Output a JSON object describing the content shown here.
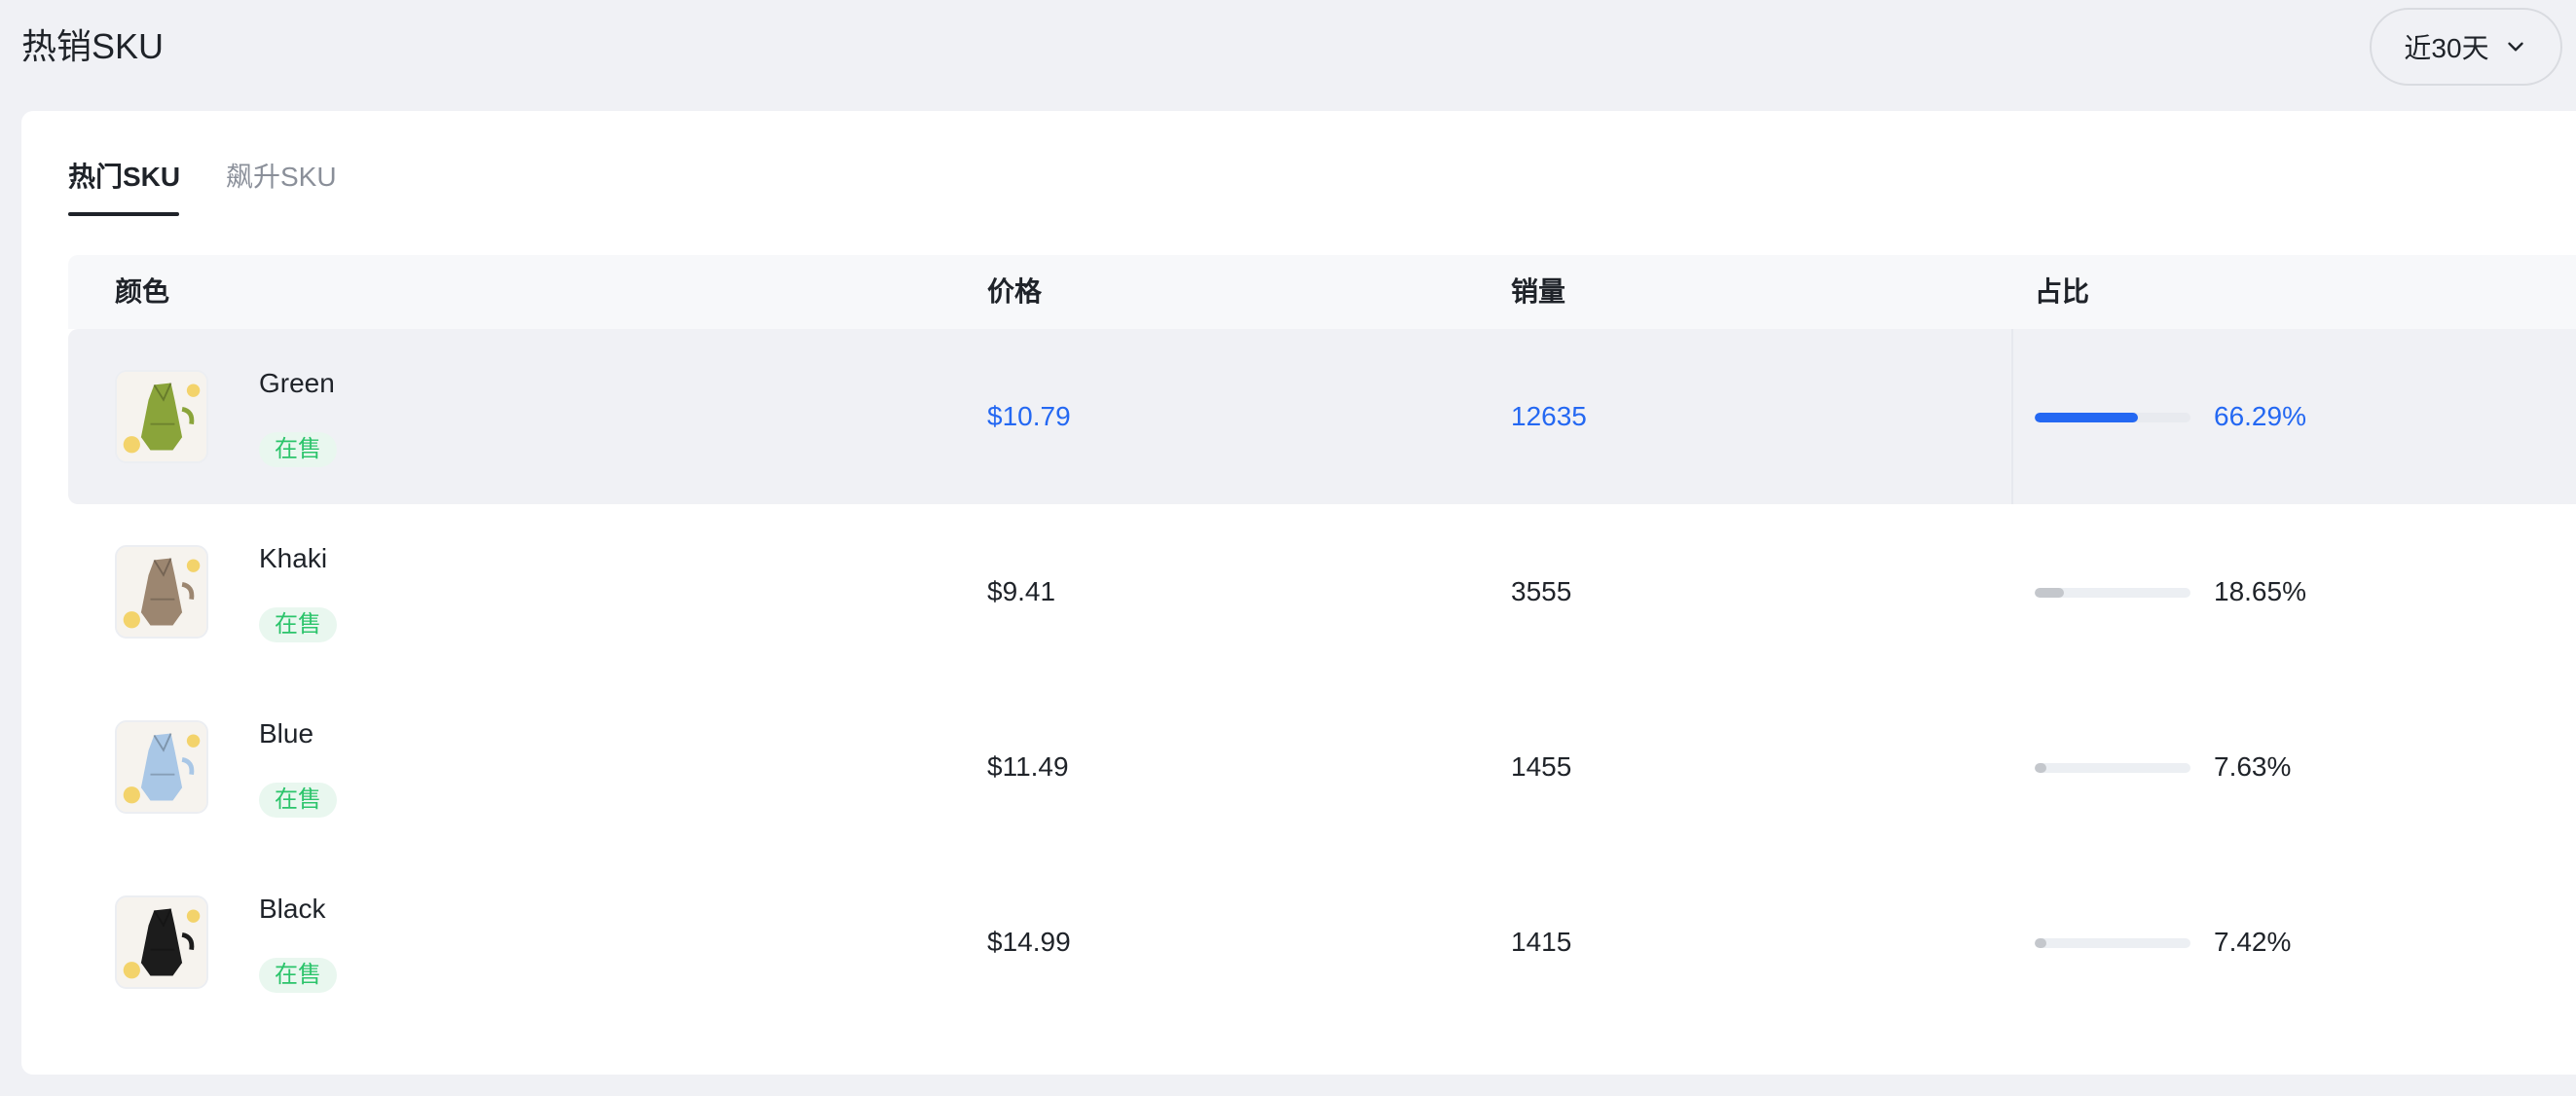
{
  "header": {
    "title": "热销SKU",
    "range_select": {
      "value": "近30天",
      "icon": "chevron-down-icon"
    }
  },
  "tabs": [
    {
      "label": "热门SKU",
      "active": true
    },
    {
      "label": "飙升SKU",
      "active": false
    }
  ],
  "table": {
    "columns": [
      "颜色",
      "价格",
      "销量",
      "占比"
    ],
    "rows": [
      {
        "color": "Green",
        "status": "在售",
        "price": "$10.79",
        "sales": "12635",
        "share": "66.29%",
        "share_value": 66.29,
        "swatch": "#8aa43a",
        "highlighted": true
      },
      {
        "color": "Khaki",
        "status": "在售",
        "price": "$9.41",
        "sales": "3555",
        "share": "18.65%",
        "share_value": 18.65,
        "swatch": "#9c8670",
        "highlighted": false
      },
      {
        "color": "Blue",
        "status": "在售",
        "price": "$11.49",
        "sales": "1455",
        "share": "7.63%",
        "share_value": 7.63,
        "swatch": "#a9c7e6",
        "highlighted": false
      },
      {
        "color": "Black",
        "status": "在售",
        "price": "$14.99",
        "sales": "1415",
        "share": "7.42%",
        "share_value": 7.42,
        "swatch": "#1c1c1c",
        "highlighted": false
      }
    ]
  },
  "colors": {
    "accent": "#2468f2",
    "status_green": "#2cc46b",
    "bar_gray": "#c4c7cc"
  }
}
